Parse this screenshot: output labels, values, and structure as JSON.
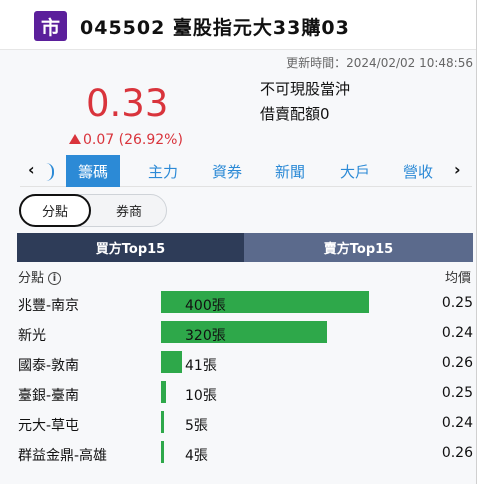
{
  "header": {
    "badge": "市",
    "title": "045502 臺股指元大33購03"
  },
  "quote": {
    "updated": "更新時間：2024/02/02 10:48:56",
    "price": "0.33",
    "change": "0.07 (26.92%)",
    "flag_daytrade": "不可現股當沖",
    "flag_shortsell": "借賣配額0",
    "up_color": "#d9343c"
  },
  "tabs": {
    "left_arrow": "‹",
    "right_arrow": "›",
    "items": [
      "籌碼",
      "主力",
      "資券",
      "新聞",
      "大戶",
      "營收"
    ],
    "active_index": 0
  },
  "segment": {
    "options": [
      "分點",
      "券商"
    ],
    "selected": "分點"
  },
  "split": {
    "buy_label": "買方Top15",
    "sell_label": "賣方Top15",
    "selected": "buy"
  },
  "table": {
    "col_broker": "分點",
    "col_avg": "均價",
    "rows": [
      {
        "broker": "兆豐-南京",
        "lots": "400張",
        "lots_value": 400,
        "avg": "0.25"
      },
      {
        "broker": "新光",
        "lots": "320張",
        "lots_value": 320,
        "avg": "0.24"
      },
      {
        "broker": "國泰-敦南",
        "lots": "41張",
        "lots_value": 41,
        "avg": "0.26"
      },
      {
        "broker": "臺銀-臺南",
        "lots": "10張",
        "lots_value": 10,
        "avg": "0.25"
      },
      {
        "broker": "元大-草屯",
        "lots": "5張",
        "lots_value": 5,
        "avg": "0.24"
      },
      {
        "broker": "群益金鼎-高雄",
        "lots": "4張",
        "lots_value": 4,
        "avg": "0.26"
      }
    ]
  }
}
